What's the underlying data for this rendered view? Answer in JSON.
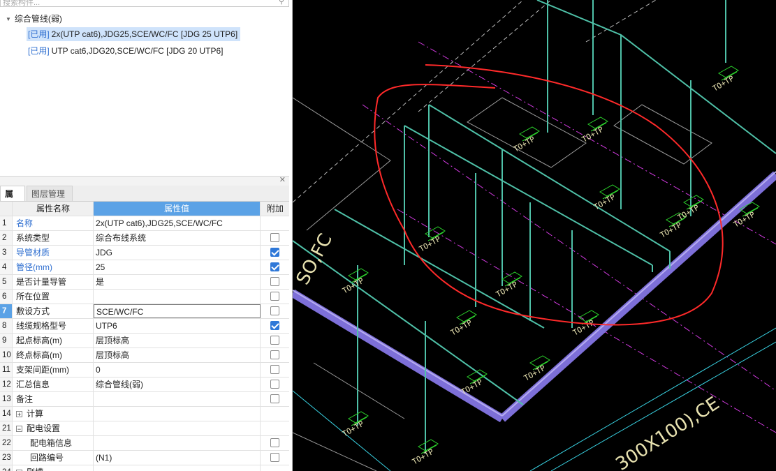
{
  "search": {
    "placeholder": "搜索构件..."
  },
  "tree": {
    "group_label": "综合管线(弱)",
    "items": [
      {
        "tag": "[已用]",
        "label": "2x(UTP cat6),JDG25,SCE/WC/FC [JDG 25 UTP6]",
        "selected": true
      },
      {
        "tag": "[已用]",
        "label": "UTP cat6,JDG20,SCE/WC/FC [JDG 20 UTP6]",
        "selected": false
      }
    ]
  },
  "tabs": {
    "properties": "属性",
    "layer_management": "图层管理"
  },
  "table": {
    "col_name": "属性名称",
    "col_value": "属性值",
    "col_extra": "附加",
    "rows": [
      {
        "num": "1",
        "name": "名称",
        "value": "2x(UTP cat6),JDG25,SCE/WC/FC",
        "blue": true,
        "checkbox": null
      },
      {
        "num": "2",
        "name": "系统类型",
        "value": "综合布线系统",
        "blue": false,
        "checkbox": false
      },
      {
        "num": "3",
        "name": "导管材质",
        "value": "JDG",
        "blue": true,
        "checkbox": true
      },
      {
        "num": "4",
        "name": "管径(mm)",
        "value": "25",
        "blue": true,
        "checkbox": true
      },
      {
        "num": "5",
        "name": "是否计量导管",
        "value": "是",
        "blue": false,
        "checkbox": false
      },
      {
        "num": "6",
        "name": "所在位置",
        "value": "",
        "blue": false,
        "checkbox": false
      },
      {
        "num": "7",
        "name": "敷设方式",
        "value": "SCE/WC/FC",
        "blue": false,
        "checkbox": false,
        "selected": true
      },
      {
        "num": "8",
        "name": "线缆规格型号",
        "value": "UTP6",
        "blue": false,
        "checkbox": true
      },
      {
        "num": "9",
        "name": "起点标高(m)",
        "value": "层顶标高",
        "blue": false,
        "checkbox": false
      },
      {
        "num": "10",
        "name": "终点标高(m)",
        "value": "层顶标高",
        "blue": false,
        "checkbox": false
      },
      {
        "num": "11",
        "name": "支架间距(mm)",
        "value": "0",
        "blue": false,
        "checkbox": false
      },
      {
        "num": "12",
        "name": "汇总信息",
        "value": "综合管线(弱)",
        "blue": false,
        "checkbox": false
      },
      {
        "num": "13",
        "name": "备注",
        "value": "",
        "blue": false,
        "checkbox": false
      },
      {
        "num": "14",
        "name": "计算",
        "value": "",
        "blue": false,
        "checkbox": null,
        "expander": "+"
      },
      {
        "num": "21",
        "name": "配电设置",
        "value": "",
        "blue": false,
        "checkbox": null,
        "expander": "−"
      },
      {
        "num": "22",
        "name": "配电箱信息",
        "value": "",
        "blue": false,
        "checkbox": false,
        "indent": true
      },
      {
        "num": "23",
        "name": "回路编号",
        "value": "(N1)",
        "blue": false,
        "checkbox": false,
        "indent": true
      },
      {
        "num": "24",
        "name": "剔槽",
        "value": "",
        "blue": false,
        "checkbox": null,
        "expander": "+"
      }
    ]
  },
  "cad": {
    "annotations": [
      "TO+TP",
      "300X100),CE",
      "SO,FC"
    ],
    "colors": {
      "background": "#000000",
      "pipe": "#4fc1a8",
      "tray": "#8a7be0",
      "markup": "#ff2a2a",
      "socket": "#2bd12b",
      "label": "#e8e2b0"
    }
  }
}
